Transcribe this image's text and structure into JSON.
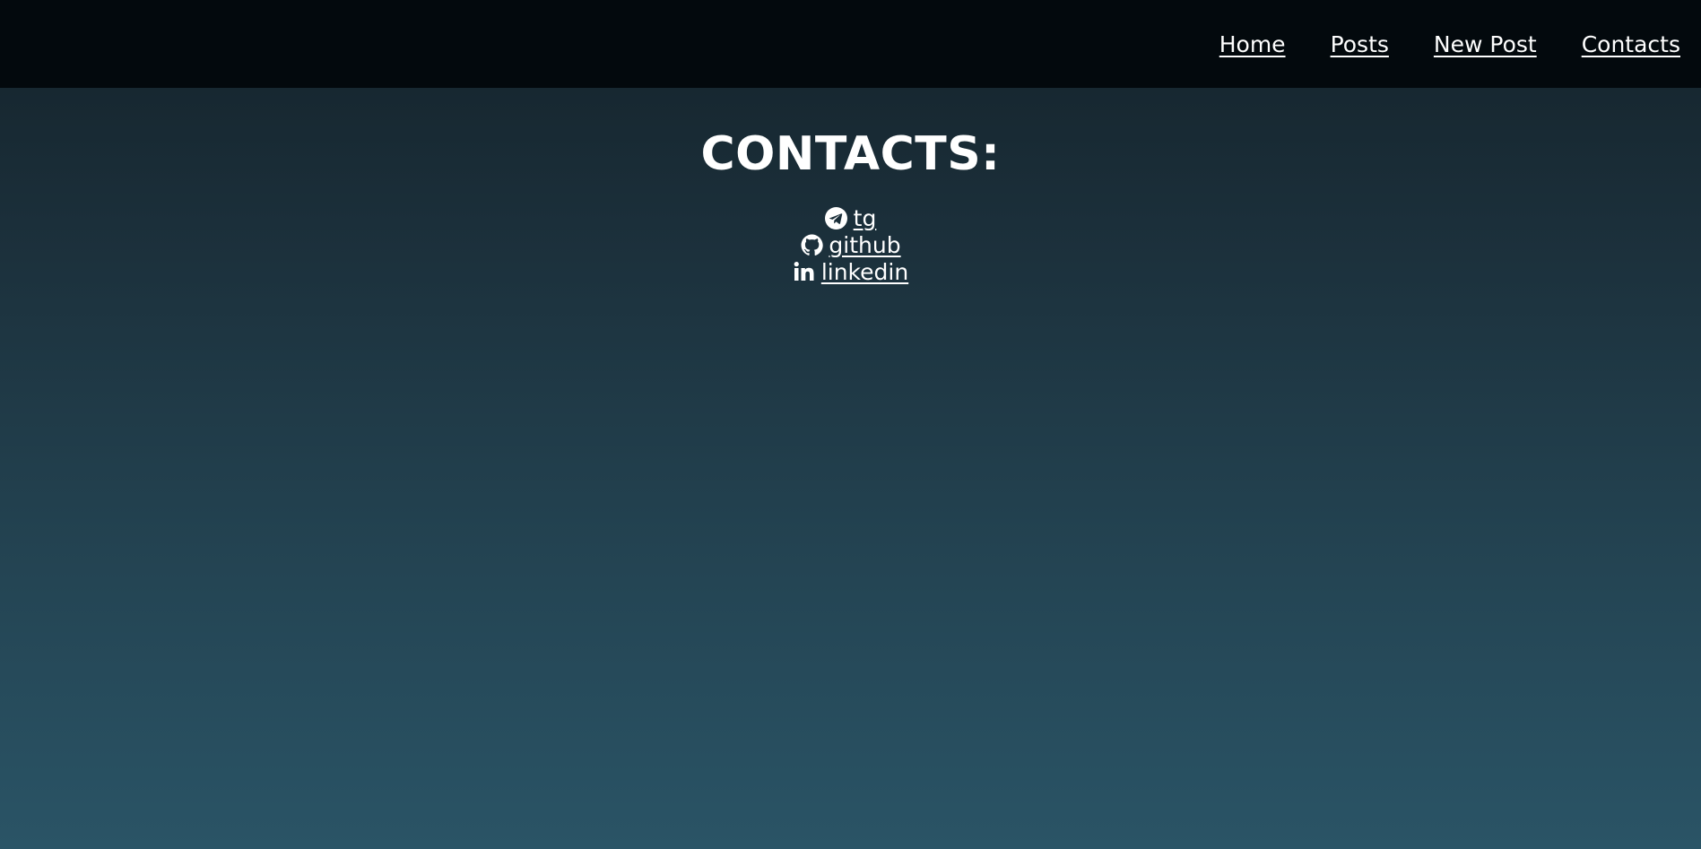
{
  "nav": {
    "items": [
      {
        "label": "Home"
      },
      {
        "label": "Posts"
      },
      {
        "label": "New Post"
      },
      {
        "label": "Contacts"
      }
    ]
  },
  "main": {
    "title": "CONTACTS:",
    "contacts": [
      {
        "label": "tg",
        "icon": "telegram-icon"
      },
      {
        "label": "github",
        "icon": "github-icon"
      },
      {
        "label": "linkedin",
        "icon": "linkedin-icon"
      }
    ]
  },
  "colors": {
    "navbar_bg": "#03090d",
    "gradient_top": "#14232b",
    "gradient_bottom": "#2a5466",
    "text": "#ffffff"
  }
}
